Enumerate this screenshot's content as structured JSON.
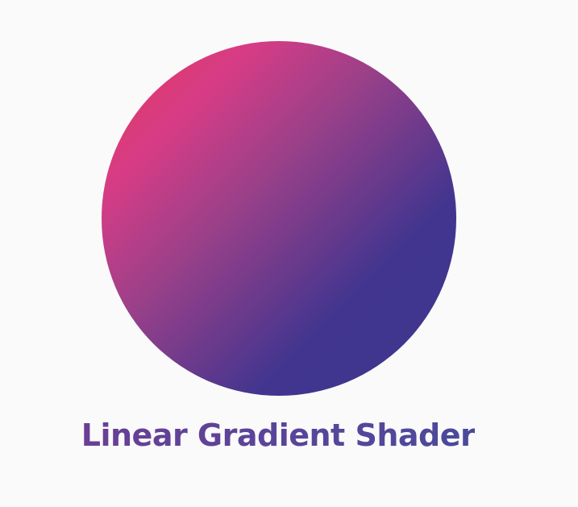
{
  "caption": {
    "text": "Linear Gradient Shader"
  },
  "colors": {
    "background": "#fafafa",
    "gradient_start": "#e53957",
    "gradient_mid": "#d63c86",
    "gradient_end": "#3f378e",
    "caption_text": "#5a4599"
  }
}
